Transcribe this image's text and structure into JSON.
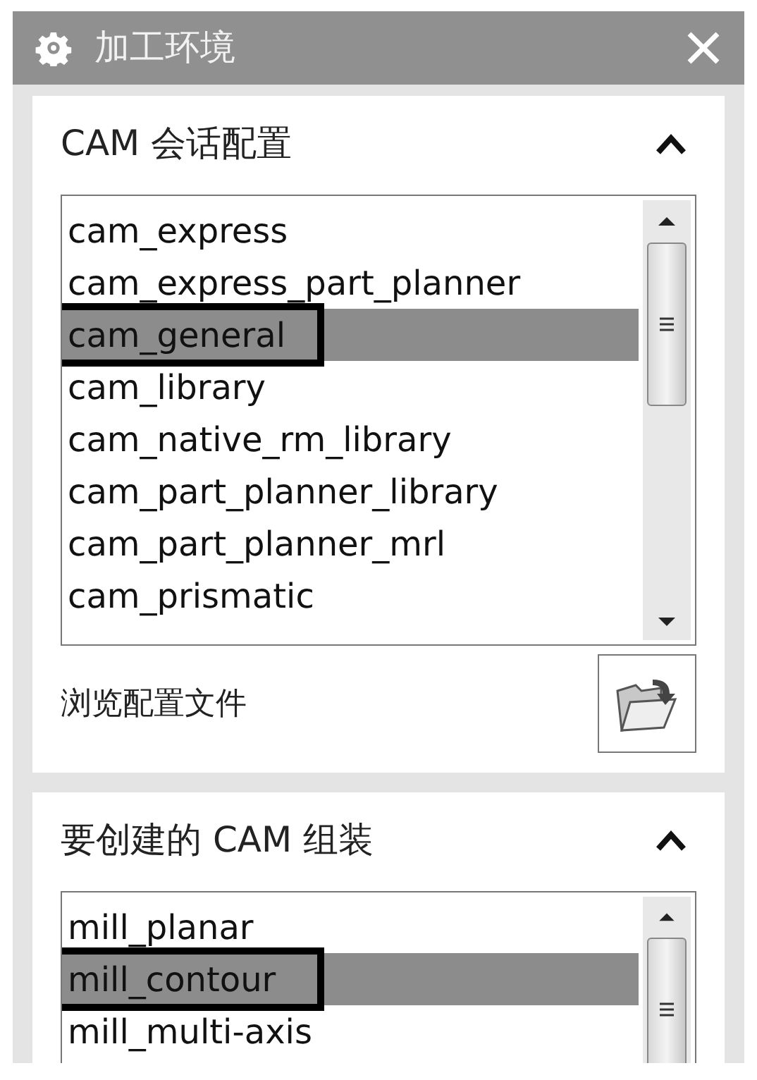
{
  "window": {
    "title": "加工环境"
  },
  "sections": [
    {
      "title": "CAM 会话配置",
      "expanded": true,
      "items": [
        {
          "text": "cam_express",
          "selected": false,
          "marked": false
        },
        {
          "text": "cam_express_part_planner",
          "selected": false,
          "marked": false
        },
        {
          "text": "cam_general",
          "selected": true,
          "marked": true
        },
        {
          "text": "cam_library",
          "selected": false,
          "marked": false
        },
        {
          "text": "cam_native_rm_library",
          "selected": false,
          "marked": false
        },
        {
          "text": "cam_part_planner_library",
          "selected": false,
          "marked": false
        },
        {
          "text": "cam_part_planner_mrl",
          "selected": false,
          "marked": false
        },
        {
          "text": "cam_prismatic",
          "selected": false,
          "marked": false
        }
      ],
      "browse_label": "浏览配置文件"
    },
    {
      "title": "要创建的 CAM 组装",
      "expanded": true,
      "items": [
        {
          "text": "mill_planar",
          "selected": false,
          "marked": false
        },
        {
          "text": "mill_contour",
          "selected": true,
          "marked": true
        },
        {
          "text": "mill_multi-axis",
          "selected": false,
          "marked": false
        }
      ]
    }
  ]
}
